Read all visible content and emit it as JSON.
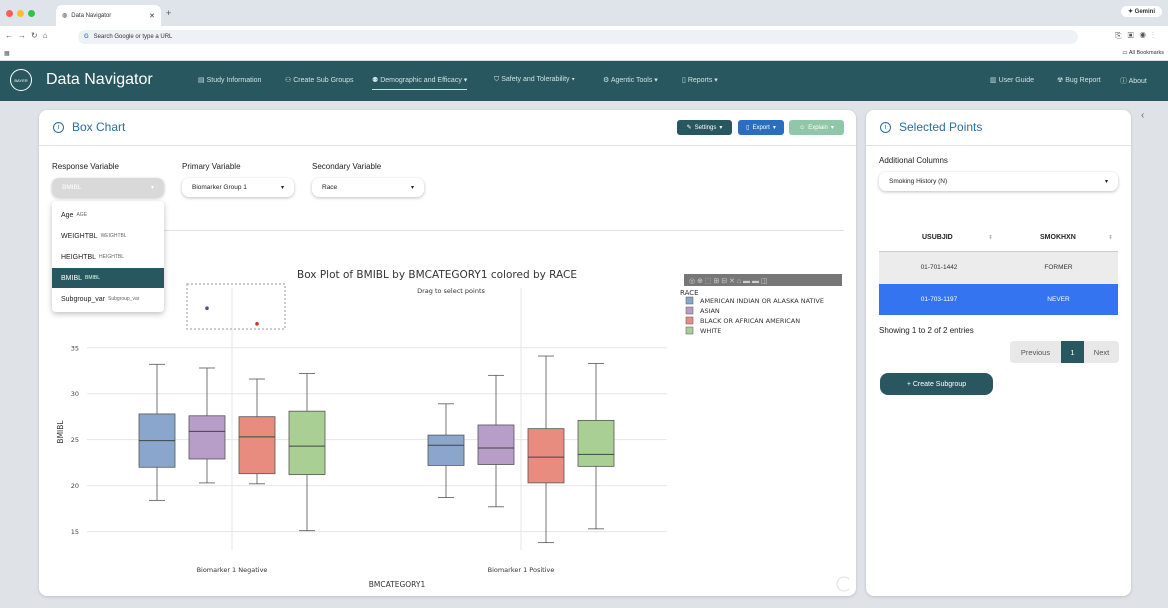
{
  "browser": {
    "tab_title": "Data Navigator",
    "omnibox_placeholder": "Search Google or type a URL",
    "gemini_label": "Gemini",
    "all_bookmarks": "All Bookmarks"
  },
  "nav": {
    "app_name": "Data Navigator",
    "logo_text": "BAYER",
    "items": [
      "Study Information",
      "Create Sub Groups",
      "Demographic and Efficacy",
      "Safety and Tolerability",
      "Agentic Tools",
      "Reports"
    ],
    "right_items": [
      "User Guide",
      "Bug Report",
      "About"
    ]
  },
  "box_chart": {
    "title": "Box Chart",
    "settings_label": "Settings",
    "export_label": "Export",
    "explain_label": "Explain",
    "response_label": "Response Variable",
    "response_value": "BMIBL",
    "primary_label": "Primary Variable",
    "primary_value": "Biomarker Group 1",
    "secondary_label": "Secondary Variable",
    "secondary_value": "Race",
    "dropdown_options": [
      {
        "name": "Age",
        "code": "AGE"
      },
      {
        "name": "WEIGHTBL",
        "code": "WEIGHTBL"
      },
      {
        "name": "HEIGHTBL",
        "code": "HEIGHTBL"
      },
      {
        "name": "BMIBL",
        "code": "BMIBL"
      },
      {
        "name": "Subgroup_var",
        "code": "Subgroup_var"
      }
    ]
  },
  "chart_data": {
    "type": "box",
    "title": "Box Plot of BMIBL by BMCATEGORY1 colored by RACE",
    "subtitle": "Drag to select points",
    "xlabel": "BMCATEGORY1",
    "ylabel": "BMIBL",
    "categories": [
      "Biomarker 1 Negative",
      "Biomarker 1 Positive"
    ],
    "yticks": [
      15,
      20,
      25,
      30,
      35
    ],
    "ylim": [
      13,
      41.5
    ],
    "legend_title": "RACE",
    "legend_position": "top-right",
    "series": [
      {
        "name": "AMERICAN INDIAN OR ALASKA NATIVE",
        "color": "#8aa6cc",
        "boxes": [
          {
            "min": 18.4,
            "q1": 22.0,
            "median": 24.9,
            "q3": 27.8,
            "max": 33.2
          },
          {
            "min": 18.7,
            "q1": 22.2,
            "median": 24.4,
            "q3": 25.5,
            "max": 28.9
          }
        ]
      },
      {
        "name": "ASIAN",
        "color": "#b69ec9",
        "boxes": [
          {
            "min": 20.3,
            "q1": 22.9,
            "median": 25.9,
            "q3": 27.6,
            "max": 32.8
          },
          {
            "min": 17.7,
            "q1": 22.3,
            "median": 24.1,
            "q3": 26.6,
            "max": 32.0
          }
        ]
      },
      {
        "name": "BLACK OR AFRICAN AMERICAN",
        "color": "#e88c80",
        "boxes": [
          {
            "min": 20.2,
            "q1": 21.3,
            "median": 25.3,
            "q3": 27.5,
            "max": 31.6
          },
          {
            "min": 13.8,
            "q1": 20.3,
            "median": 23.1,
            "q3": 26.2,
            "max": 34.1
          }
        ]
      },
      {
        "name": "WHITE",
        "color": "#a9cf94",
        "boxes": [
          {
            "min": 15.1,
            "q1": 21.2,
            "median": 24.3,
            "q3": 28.1,
            "max": 32.2
          },
          {
            "min": 15.3,
            "q1": 22.1,
            "median": 23.4,
            "q3": 27.1,
            "max": 33.3
          }
        ]
      }
    ],
    "selected_points": [
      {
        "x": "Biomarker 1 Negative",
        "series": "ASIAN",
        "y": 39.3
      },
      {
        "x": "Biomarker 1 Negative",
        "series": "BLACK OR AFRICAN AMERICAN",
        "y": 37.6
      }
    ]
  },
  "selected": {
    "title": "Selected Points",
    "additional_label": "Additional Columns",
    "additional_value": "Smoking History (N)",
    "columns": [
      "USUBJID",
      "SMOKHXN"
    ],
    "rows": [
      [
        "01-701-1442",
        "FORMER"
      ],
      [
        "01-703-1197",
        "NEVER"
      ]
    ],
    "info": "Showing 1 to 2 of 2 entries",
    "prev": "Previous",
    "page": "1",
    "next": "Next",
    "create_label": "+ Create Subgroup"
  },
  "colors": {
    "nav": "#29575f",
    "accent": "#2a6e9c",
    "selected_row": "#3574f0"
  }
}
